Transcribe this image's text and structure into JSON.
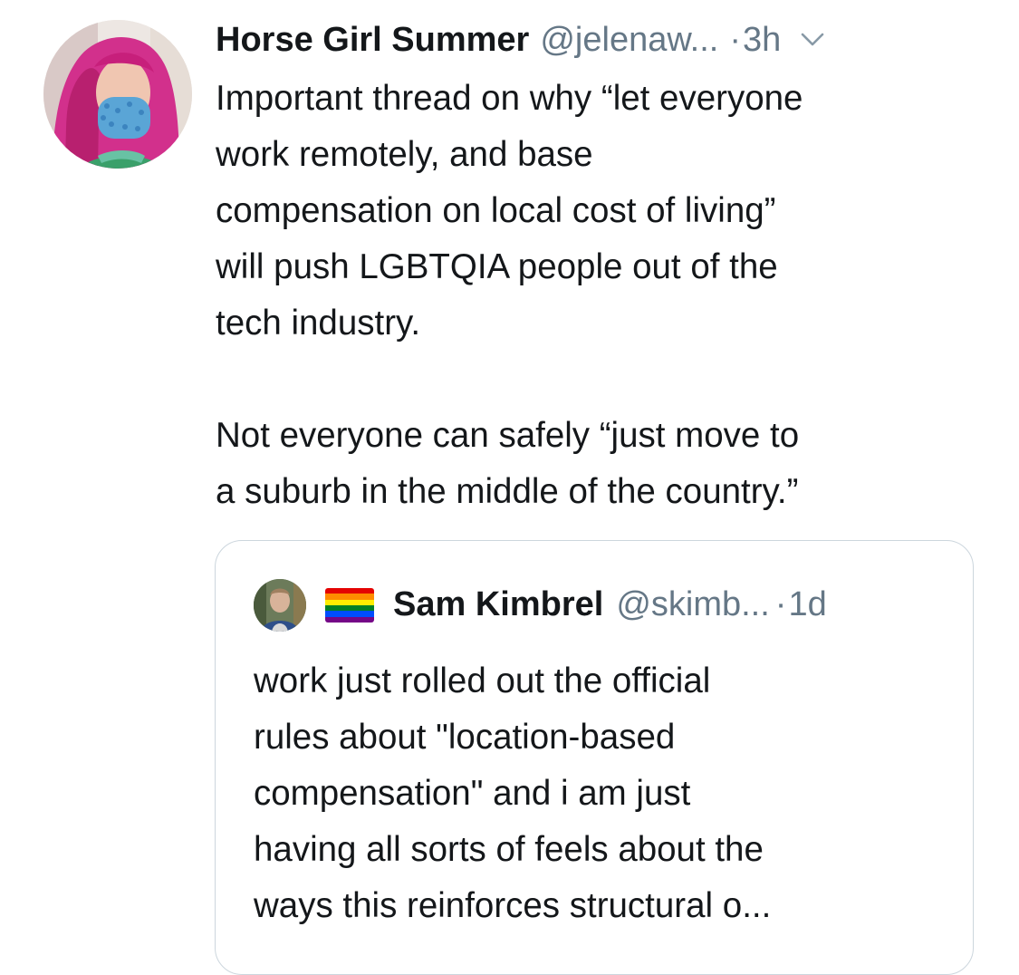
{
  "tweet": {
    "display_name": "Horse Girl Summer",
    "handle": "@jelenaw...",
    "dot": "·",
    "time": "3h",
    "menu_icon": "chevron-down-icon",
    "avatar_icon": "profile-photo-avatar",
    "text": "Important thread on why “let everyone\nwork remotely, and base\ncompensation on local cost of living”\nwill push LGBTQIA people out of the\ntech industry.\n\nNot everyone can safely “just move to\na suburb in the middle of the country.”"
  },
  "quoted_tweet": {
    "display_name": "Sam Kimbrel",
    "handle": "@skimb...",
    "dot": "·",
    "time": "1d",
    "flag_icon": "rainbow-flag-icon",
    "flag_colors": [
      "#e40303",
      "#ff8c00",
      "#ffed00",
      "#008026",
      "#004dff",
      "#750787"
    ],
    "text": "work just rolled out the official\nrules about \"location-based\ncompensation\" and i am just\nhaving all sorts of feels about the\nways this reinforces structural o..."
  },
  "colors": {
    "text_primary": "#14171a",
    "text_secondary": "#657786",
    "border": "#ccd6dd"
  }
}
